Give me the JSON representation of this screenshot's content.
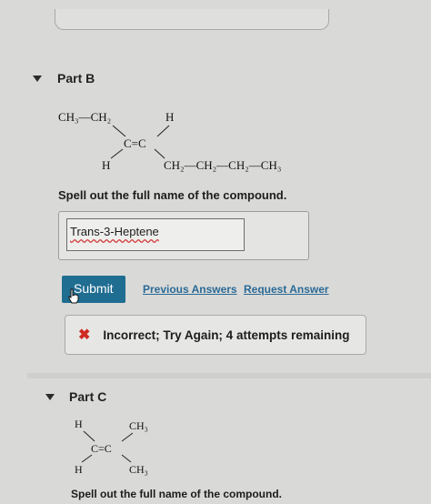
{
  "partB": {
    "title": "Part B",
    "molecule": {
      "top_left": "CH₃—CH₂",
      "top_right": "H",
      "center": "C=C",
      "bottom_left": "H",
      "bottom_right": "CH₂—CH₂—CH₂—CH₃"
    },
    "prompt": "Spell out the full name of the compound.",
    "answer_value": "Trans-3-Heptene",
    "submit_label": "Submit",
    "previous_answers_label": "Previous Answers",
    "request_answer_label": "Request Answer",
    "feedback": "Incorrect; Try Again; 4 attempts remaining",
    "feedback_icon": "✖"
  },
  "partC": {
    "title": "Part C",
    "molecule": {
      "top_left": "H",
      "top_right": "CH₃",
      "center": "C=C",
      "bottom_left": "H",
      "bottom_right": "CH₃"
    },
    "prompt": "Spell out the full name of the compound."
  },
  "colors": {
    "submit": "#1f6d91",
    "link": "#2b6a96",
    "error": "#cf2a22"
  }
}
